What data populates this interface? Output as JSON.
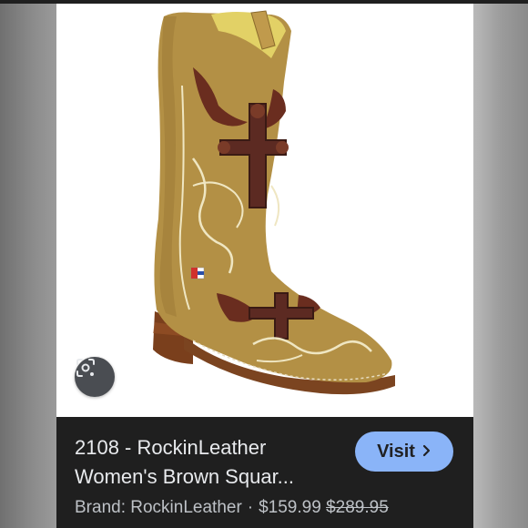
{
  "product": {
    "title_line1": "2108 - RockinLeather",
    "title_line2": "Women's Brown Squar...",
    "brand": "Brand: RockinLeather",
    "separator": "·",
    "price": "$159.99",
    "original_price": "$289.95"
  },
  "actions": {
    "visit_label": "Visit",
    "visit_icon": "chevron-right-icon",
    "lens_icon": "lens-search-icon"
  },
  "colors": {
    "visit_button": "#8ab4f8",
    "info_background": "#1f1f1f",
    "boot_leather": "#b39045"
  }
}
